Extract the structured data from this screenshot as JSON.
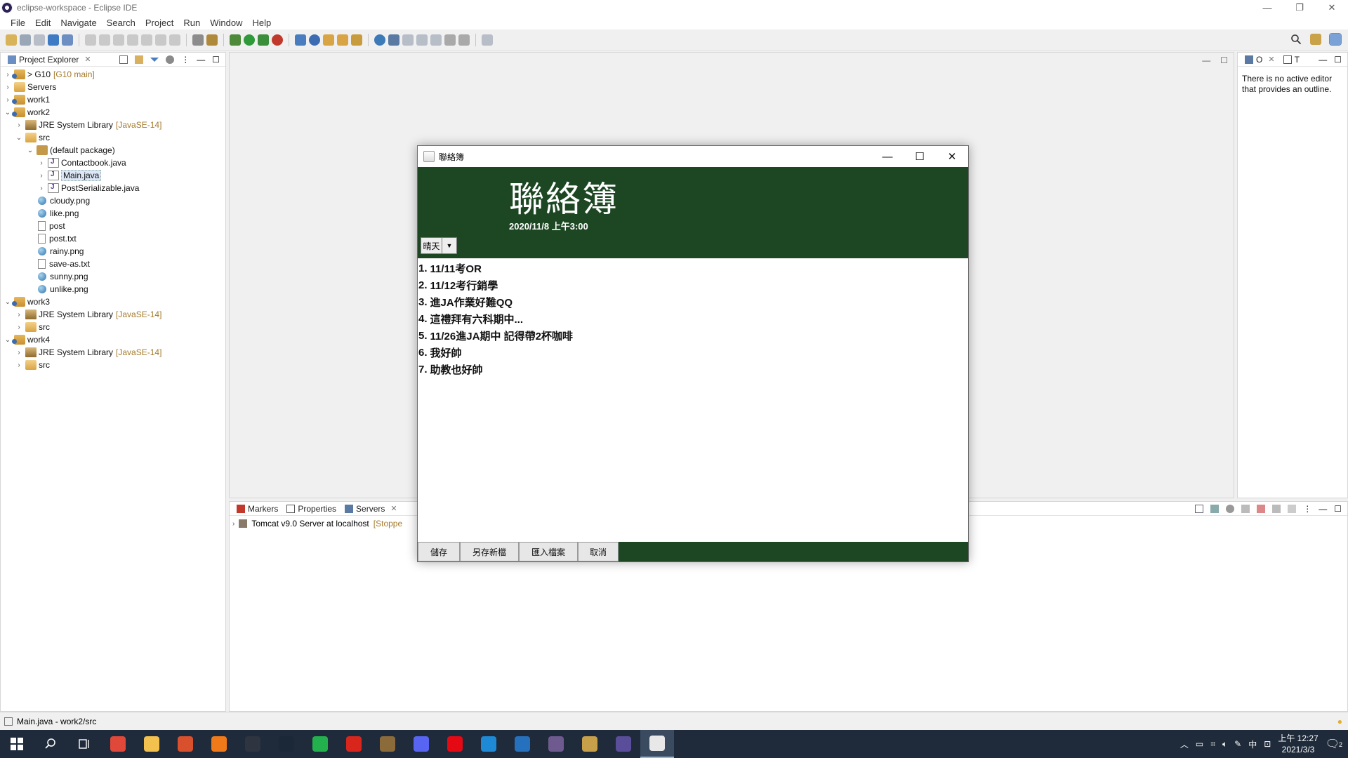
{
  "window": {
    "title": "eclipse-workspace - Eclipse IDE",
    "controls": [
      "—",
      "❐",
      "✕"
    ]
  },
  "menu": [
    "File",
    "Edit",
    "Navigate",
    "Search",
    "Project",
    "Run",
    "Window",
    "Help"
  ],
  "explorer": {
    "tab_label": "Project Explorer",
    "tree": [
      {
        "indent": 0,
        "arrow": "›",
        "icon": "project",
        "label": "> G10",
        "deco": "[G10 main]"
      },
      {
        "indent": 0,
        "arrow": "›",
        "icon": "folder",
        "label": "Servers",
        "deco": ""
      },
      {
        "indent": 0,
        "arrow": "›",
        "icon": "project",
        "label": "work1",
        "deco": ""
      },
      {
        "indent": 0,
        "arrow": "⌄",
        "icon": "project",
        "label": "work2",
        "deco": ""
      },
      {
        "indent": 1,
        "arrow": "›",
        "icon": "lib",
        "label": "JRE System Library",
        "deco": "[JavaSE-14]"
      },
      {
        "indent": 1,
        "arrow": "⌄",
        "icon": "folder",
        "label": "src",
        "deco": ""
      },
      {
        "indent": 2,
        "arrow": "⌄",
        "icon": "pkg",
        "label": "(default package)",
        "deco": ""
      },
      {
        "indent": 3,
        "arrow": "›",
        "icon": "java",
        "label": "Contactbook.java",
        "deco": ""
      },
      {
        "indent": 3,
        "arrow": "›",
        "icon": "java",
        "label": "Main.java",
        "deco": "",
        "selected": true
      },
      {
        "indent": 3,
        "arrow": "›",
        "icon": "java",
        "label": "PostSerializable.java",
        "deco": ""
      },
      {
        "indent": 2,
        "arrow": "",
        "icon": "img",
        "label": "cloudy.png",
        "deco": ""
      },
      {
        "indent": 2,
        "arrow": "",
        "icon": "img",
        "label": "like.png",
        "deco": ""
      },
      {
        "indent": 2,
        "arrow": "",
        "icon": "file",
        "label": "post",
        "deco": ""
      },
      {
        "indent": 2,
        "arrow": "",
        "icon": "file",
        "label": "post.txt",
        "deco": ""
      },
      {
        "indent": 2,
        "arrow": "",
        "icon": "img",
        "label": "rainy.png",
        "deco": ""
      },
      {
        "indent": 2,
        "arrow": "",
        "icon": "file",
        "label": "save-as.txt",
        "deco": ""
      },
      {
        "indent": 2,
        "arrow": "",
        "icon": "img",
        "label": "sunny.png",
        "deco": ""
      },
      {
        "indent": 2,
        "arrow": "",
        "icon": "img",
        "label": "unlike.png",
        "deco": ""
      },
      {
        "indent": 0,
        "arrow": "⌄",
        "icon": "project",
        "label": "work3",
        "deco": ""
      },
      {
        "indent": 1,
        "arrow": "›",
        "icon": "lib",
        "label": "JRE System Library",
        "deco": "[JavaSE-14]"
      },
      {
        "indent": 1,
        "arrow": "›",
        "icon": "folder",
        "label": "src",
        "deco": ""
      },
      {
        "indent": 0,
        "arrow": "⌄",
        "icon": "project",
        "label": "work4",
        "deco": ""
      },
      {
        "indent": 1,
        "arrow": "›",
        "icon": "lib",
        "label": "JRE System Library",
        "deco": "[JavaSE-14]"
      },
      {
        "indent": 1,
        "arrow": "›",
        "icon": "folder",
        "label": "src",
        "deco": ""
      }
    ]
  },
  "outline": {
    "tab_o": "O",
    "tab_t": "T",
    "message": "There is no active editor that provides an outline."
  },
  "bottom_panel": {
    "tabs": [
      "Markers",
      "Properties",
      "Servers"
    ],
    "server_name": "Tomcat v9.0 Server at localhost",
    "server_status": "[Stoppe"
  },
  "statusbar": {
    "text": "Main.java - work2/src"
  },
  "taskbar": {
    "apps": [
      {
        "name": "chrome",
        "color": "#e0483a"
      },
      {
        "name": "file-explorer",
        "color": "#f2c14e"
      },
      {
        "name": "office",
        "color": "#d9502c"
      },
      {
        "name": "firefox-like",
        "color": "#f07a1a"
      },
      {
        "name": "terminal",
        "color": "#2e3440"
      },
      {
        "name": "steam",
        "color": "#1b2838"
      },
      {
        "name": "line",
        "color": "#22b14c"
      },
      {
        "name": "garena",
        "color": "#d9261c"
      },
      {
        "name": "game",
        "color": "#8b6b3a"
      },
      {
        "name": "discord",
        "color": "#5865f2"
      },
      {
        "name": "netflix",
        "color": "#e50914"
      },
      {
        "name": "vscode",
        "color": "#1e8ad6"
      },
      {
        "name": "powershell",
        "color": "#2671be"
      },
      {
        "name": "game-2",
        "color": "#6f5a8f"
      },
      {
        "name": "league",
        "color": "#c8a04a"
      },
      {
        "name": "eclipse",
        "color": "#5a4e9a"
      },
      {
        "name": "java-app",
        "color": "#e8e8e8"
      }
    ],
    "ime": "中",
    "time": "上午 12:27",
    "date": "2021/3/3",
    "notifications": "2"
  },
  "dialog": {
    "title": "聯絡簿",
    "heading": "聯絡簿",
    "date": "2020/11/8  上午3:00",
    "weather_selected": "晴天",
    "notes": [
      {
        "num": "1.",
        "text": "11/11考OR"
      },
      {
        "num": "2.",
        "text": "11/12考行銷學"
      },
      {
        "num": "3.",
        "text": "進JA作業好難QQ"
      },
      {
        "num": "4.",
        "text": "這禮拜有六科期中..."
      },
      {
        "num": "5.",
        "text": "11/26進JA期中 記得帶2杯咖啡"
      },
      {
        "num": "6.",
        "text": "我好帥"
      },
      {
        "num": "7.",
        "text": "助教也好帥"
      }
    ],
    "buttons": {
      "save": "儲存",
      "save_as": "另存新檔",
      "import": "匯入檔案",
      "cancel": "取消"
    },
    "colors": {
      "header_bg": "#1c4722",
      "footer_bg": "#1c4722"
    }
  }
}
